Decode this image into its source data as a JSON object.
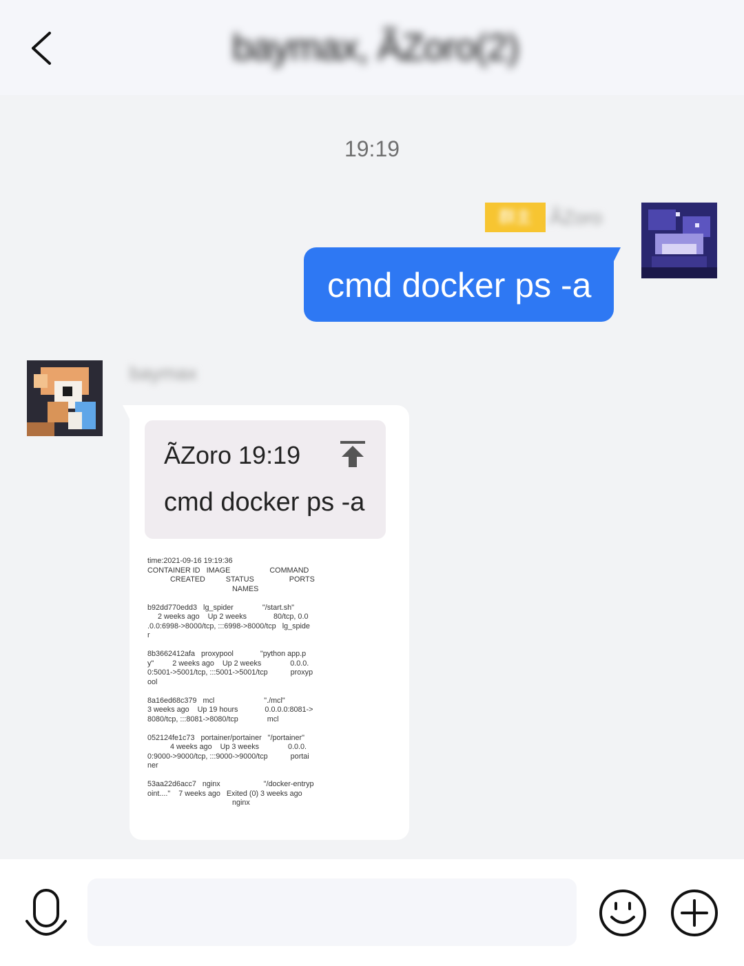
{
  "header": {
    "title": "baymax, ÃZoro(2)",
    "back_icon": "chevron-left-icon"
  },
  "chat": {
    "timestamp": "19:19",
    "outgoing": {
      "badge": "群主",
      "nickname": "ÃZoro",
      "text": "cmd docker ps -a"
    },
    "incoming": {
      "nickname": "baymax",
      "quote": {
        "author_time": "ÃZoro 19:19",
        "text": "cmd docker ps -a",
        "icon": "jump-to-top-icon"
      },
      "output": "time:2021-09-16 19:19:36\nCONTAINER ID   IMAGE                   COMMAND\n           CREATED          STATUS                 PORTS\n                                         NAMES\n\nb92dd770edd3   lg_spider              \"/start.sh\"\n     2 weeks ago    Up 2 weeks             80/tcp, 0.0\n.0.0:6998->8000/tcp, :::6998->8000/tcp   lg_spide\nr\n\n8b3662412afa   proxypool             \"python app.p\ny\"         2 weeks ago    Up 2 weeks              0.0.0.\n0:5001->5001/tcp, :::5001->5001/tcp           proxyp\nool\n\n8a16ed68c379   mcl                        \"./mcl\"\n3 weeks ago    Up 19 hours             0.0.0.0:8081->\n8080/tcp, :::8081->8080/tcp              mcl\n\n052124fe1c73   portainer/portainer   \"/portainer\"\n           4 weeks ago    Up 3 weeks              0.0.0.\n0:9000->9000/tcp, :::9000->9000/tcp           portai\nner\n\n53aa22d6acc7   nginx                     \"/docker-entryp\noint....\"    7 weeks ago   Exited (0) 3 weeks ago\n                                         nginx"
    }
  },
  "input_bar": {
    "value": "",
    "mic_icon": "microphone-icon",
    "emoji_icon": "smiley-icon",
    "plus_icon": "plus-circle-icon"
  },
  "colors": {
    "accent": "#2e78f3",
    "badge": "#f7c531",
    "background": "#f2f3f5"
  }
}
